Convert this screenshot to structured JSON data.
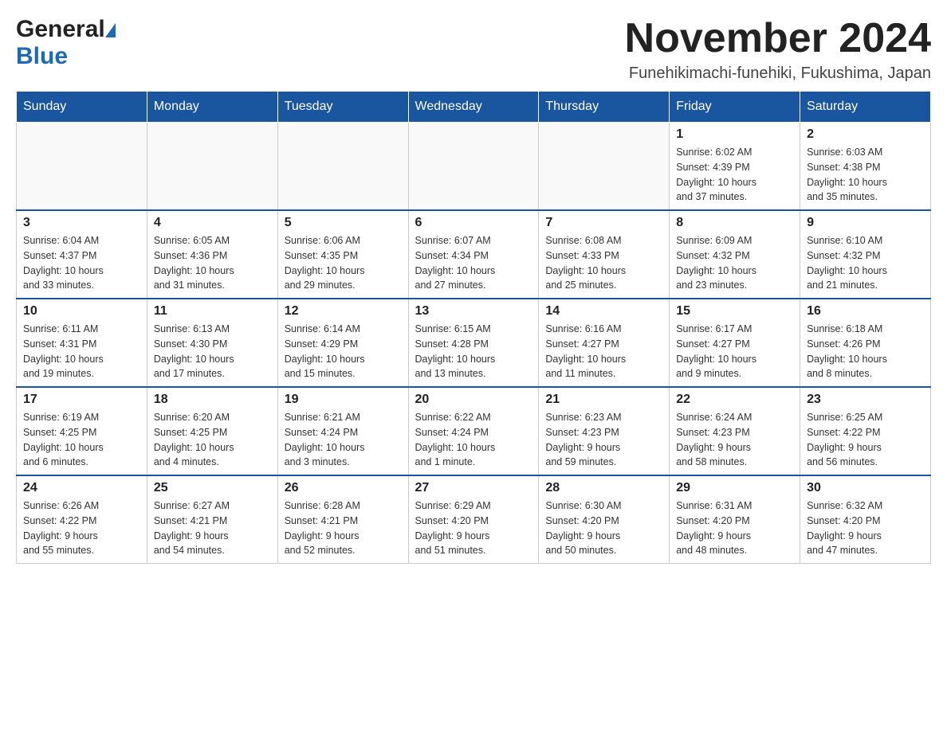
{
  "header": {
    "logo_general": "General",
    "logo_blue": "Blue",
    "month_title": "November 2024",
    "location": "Funehikimachi-funehiki, Fukushima, Japan"
  },
  "days_of_week": [
    "Sunday",
    "Monday",
    "Tuesday",
    "Wednesday",
    "Thursday",
    "Friday",
    "Saturday"
  ],
  "weeks": [
    {
      "days": [
        {
          "number": "",
          "info": ""
        },
        {
          "number": "",
          "info": ""
        },
        {
          "number": "",
          "info": ""
        },
        {
          "number": "",
          "info": ""
        },
        {
          "number": "",
          "info": ""
        },
        {
          "number": "1",
          "info": "Sunrise: 6:02 AM\nSunset: 4:39 PM\nDaylight: 10 hours\nand 37 minutes."
        },
        {
          "number": "2",
          "info": "Sunrise: 6:03 AM\nSunset: 4:38 PM\nDaylight: 10 hours\nand 35 minutes."
        }
      ]
    },
    {
      "days": [
        {
          "number": "3",
          "info": "Sunrise: 6:04 AM\nSunset: 4:37 PM\nDaylight: 10 hours\nand 33 minutes."
        },
        {
          "number": "4",
          "info": "Sunrise: 6:05 AM\nSunset: 4:36 PM\nDaylight: 10 hours\nand 31 minutes."
        },
        {
          "number": "5",
          "info": "Sunrise: 6:06 AM\nSunset: 4:35 PM\nDaylight: 10 hours\nand 29 minutes."
        },
        {
          "number": "6",
          "info": "Sunrise: 6:07 AM\nSunset: 4:34 PM\nDaylight: 10 hours\nand 27 minutes."
        },
        {
          "number": "7",
          "info": "Sunrise: 6:08 AM\nSunset: 4:33 PM\nDaylight: 10 hours\nand 25 minutes."
        },
        {
          "number": "8",
          "info": "Sunrise: 6:09 AM\nSunset: 4:32 PM\nDaylight: 10 hours\nand 23 minutes."
        },
        {
          "number": "9",
          "info": "Sunrise: 6:10 AM\nSunset: 4:32 PM\nDaylight: 10 hours\nand 21 minutes."
        }
      ]
    },
    {
      "days": [
        {
          "number": "10",
          "info": "Sunrise: 6:11 AM\nSunset: 4:31 PM\nDaylight: 10 hours\nand 19 minutes."
        },
        {
          "number": "11",
          "info": "Sunrise: 6:13 AM\nSunset: 4:30 PM\nDaylight: 10 hours\nand 17 minutes."
        },
        {
          "number": "12",
          "info": "Sunrise: 6:14 AM\nSunset: 4:29 PM\nDaylight: 10 hours\nand 15 minutes."
        },
        {
          "number": "13",
          "info": "Sunrise: 6:15 AM\nSunset: 4:28 PM\nDaylight: 10 hours\nand 13 minutes."
        },
        {
          "number": "14",
          "info": "Sunrise: 6:16 AM\nSunset: 4:27 PM\nDaylight: 10 hours\nand 11 minutes."
        },
        {
          "number": "15",
          "info": "Sunrise: 6:17 AM\nSunset: 4:27 PM\nDaylight: 10 hours\nand 9 minutes."
        },
        {
          "number": "16",
          "info": "Sunrise: 6:18 AM\nSunset: 4:26 PM\nDaylight: 10 hours\nand 8 minutes."
        }
      ]
    },
    {
      "days": [
        {
          "number": "17",
          "info": "Sunrise: 6:19 AM\nSunset: 4:25 PM\nDaylight: 10 hours\nand 6 minutes."
        },
        {
          "number": "18",
          "info": "Sunrise: 6:20 AM\nSunset: 4:25 PM\nDaylight: 10 hours\nand 4 minutes."
        },
        {
          "number": "19",
          "info": "Sunrise: 6:21 AM\nSunset: 4:24 PM\nDaylight: 10 hours\nand 3 minutes."
        },
        {
          "number": "20",
          "info": "Sunrise: 6:22 AM\nSunset: 4:24 PM\nDaylight: 10 hours\nand 1 minute."
        },
        {
          "number": "21",
          "info": "Sunrise: 6:23 AM\nSunset: 4:23 PM\nDaylight: 9 hours\nand 59 minutes."
        },
        {
          "number": "22",
          "info": "Sunrise: 6:24 AM\nSunset: 4:23 PM\nDaylight: 9 hours\nand 58 minutes."
        },
        {
          "number": "23",
          "info": "Sunrise: 6:25 AM\nSunset: 4:22 PM\nDaylight: 9 hours\nand 56 minutes."
        }
      ]
    },
    {
      "days": [
        {
          "number": "24",
          "info": "Sunrise: 6:26 AM\nSunset: 4:22 PM\nDaylight: 9 hours\nand 55 minutes."
        },
        {
          "number": "25",
          "info": "Sunrise: 6:27 AM\nSunset: 4:21 PM\nDaylight: 9 hours\nand 54 minutes."
        },
        {
          "number": "26",
          "info": "Sunrise: 6:28 AM\nSunset: 4:21 PM\nDaylight: 9 hours\nand 52 minutes."
        },
        {
          "number": "27",
          "info": "Sunrise: 6:29 AM\nSunset: 4:20 PM\nDaylight: 9 hours\nand 51 minutes."
        },
        {
          "number": "28",
          "info": "Sunrise: 6:30 AM\nSunset: 4:20 PM\nDaylight: 9 hours\nand 50 minutes."
        },
        {
          "number": "29",
          "info": "Sunrise: 6:31 AM\nSunset: 4:20 PM\nDaylight: 9 hours\nand 48 minutes."
        },
        {
          "number": "30",
          "info": "Sunrise: 6:32 AM\nSunset: 4:20 PM\nDaylight: 9 hours\nand 47 minutes."
        }
      ]
    }
  ]
}
